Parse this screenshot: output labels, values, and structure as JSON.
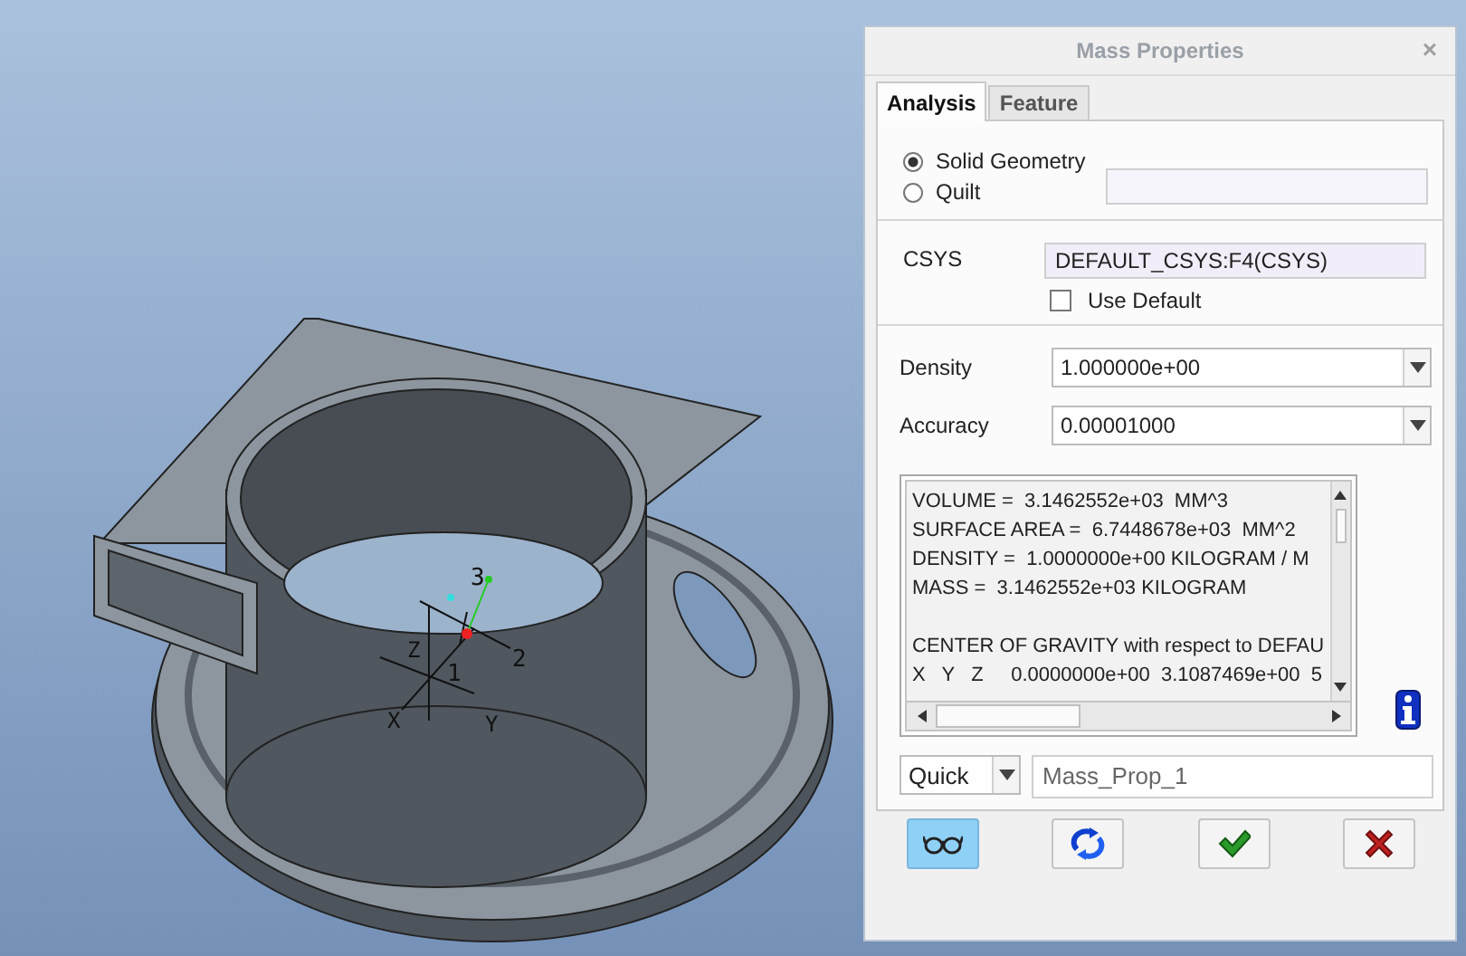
{
  "viewport": {
    "axis_labels": [
      {
        "text": "3",
        "kind": "datum"
      },
      {
        "text": "2",
        "kind": "datum"
      },
      {
        "text": "1",
        "kind": "datum"
      },
      {
        "text": "Z",
        "kind": "world"
      },
      {
        "text": "X",
        "kind": "world"
      },
      {
        "text": "Y",
        "kind": "world"
      }
    ]
  },
  "window": {
    "title": "Mass Properties",
    "close": "×"
  },
  "tabs": [
    {
      "label": "Analysis",
      "selected": true
    },
    {
      "label": "Feature",
      "selected": false
    }
  ],
  "geometry_options": [
    {
      "label": "Solid Geometry",
      "selected": true
    },
    {
      "label": "Quilt",
      "selected": false
    }
  ],
  "csys": {
    "label": "CSYS",
    "value": "DEFAULT_CSYS:F4(CSYS)",
    "use_default": {
      "label": "Use Default",
      "checked": false
    }
  },
  "density": {
    "label": "Density",
    "value": "1.000000e+00"
  },
  "accuracy": {
    "label": "Accuracy",
    "value": "0.00001000"
  },
  "results": {
    "paragraphs": [
      [
        "VOLUME =  3.1462552e+03  MM^3",
        "SURFACE AREA =  6.7448678e+03  MM^2",
        "DENSITY =  1.0000000e+00 KILOGRAM / M",
        "MASS =  3.1462552e+03 KILOGRAM"
      ],
      [
        "CENTER OF GRAVITY with respect to DEFAU",
        "X   Y   Z     0.0000000e+00  3.1087469e+00  5"
      ]
    ]
  },
  "mode": {
    "value": "Quick"
  },
  "analysis_name": {
    "value": "Mass_Prop_1"
  },
  "buttons": [
    {
      "kind": "preview",
      "selected": true
    },
    {
      "kind": "repeat",
      "selected": false
    },
    {
      "kind": "ok",
      "selected": false
    },
    {
      "kind": "cancel",
      "selected": false
    }
  ]
}
